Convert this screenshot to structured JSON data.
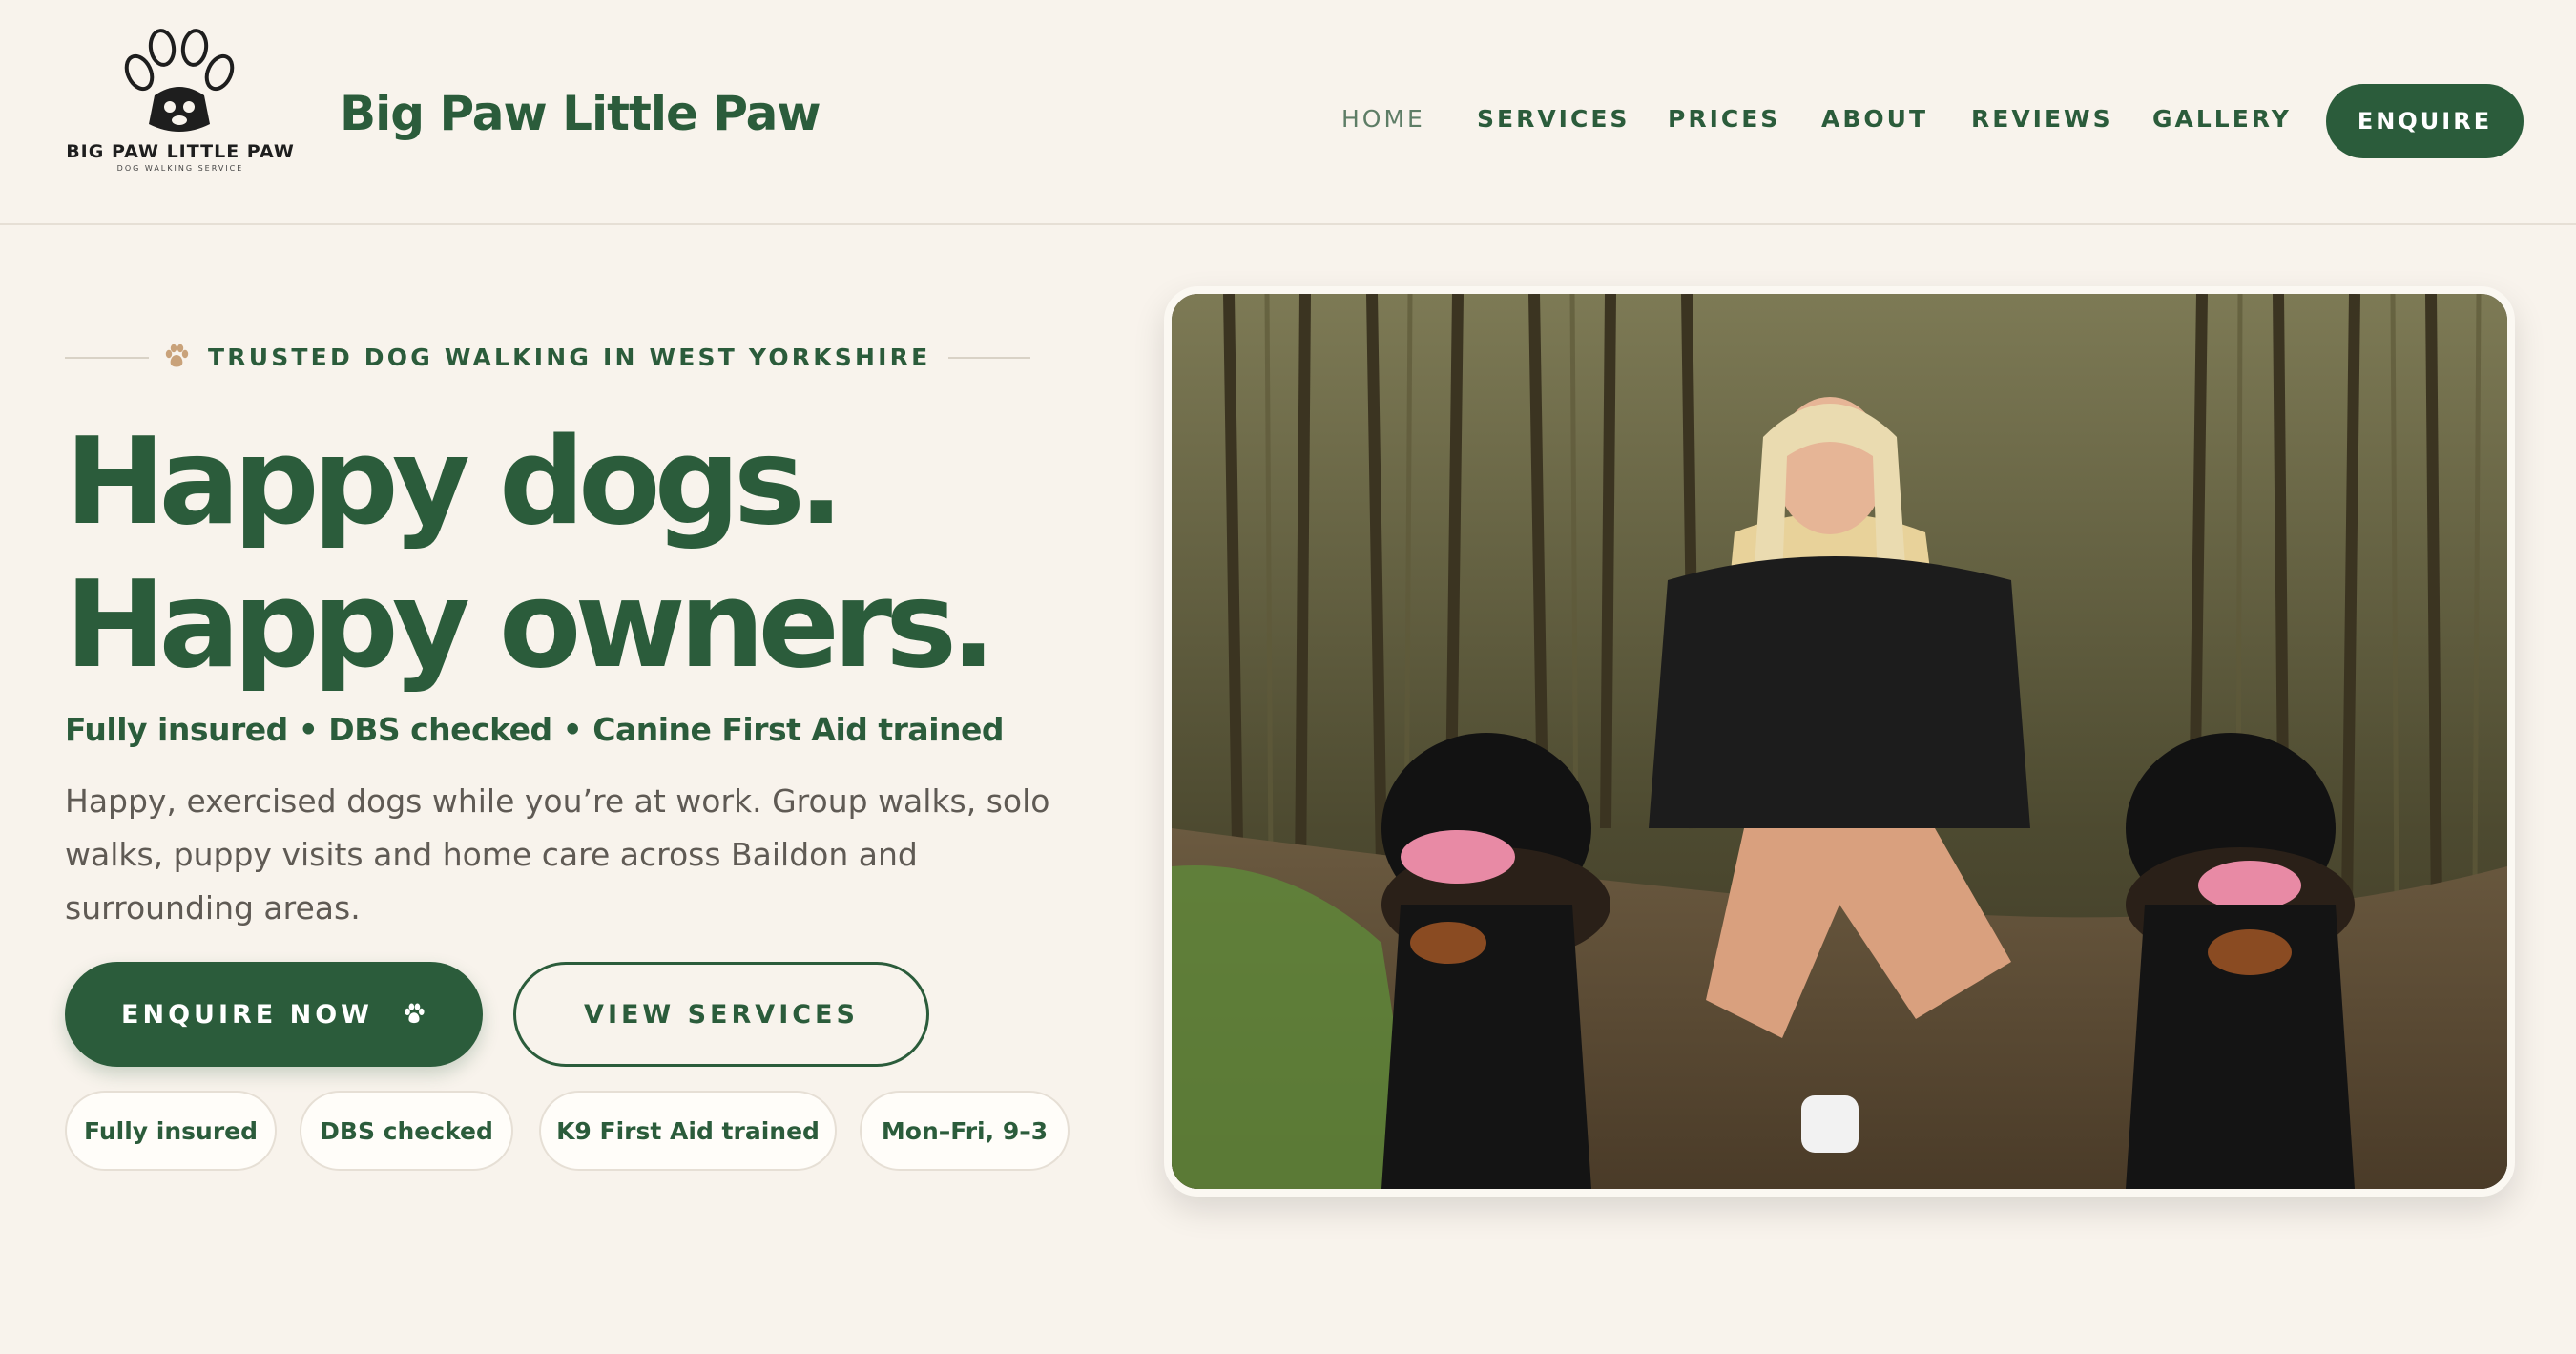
{
  "header": {
    "logo": {
      "title": "BIG PAW LITTLE PAW",
      "subtitle": "DOG WALKING SERVICE",
      "icon": "paw-print-with-dog-logo"
    },
    "brand_name": "Big Paw Little Paw",
    "nav": [
      {
        "label": "HOME",
        "active": true
      },
      {
        "label": "SERVICES",
        "active": false
      },
      {
        "label": "PRICES",
        "active": false
      },
      {
        "label": "ABOUT",
        "active": false
      },
      {
        "label": "REVIEWS",
        "active": false
      },
      {
        "label": "GALLERY",
        "active": false
      }
    ],
    "cta_label": "ENQUIRE"
  },
  "hero": {
    "eyebrow": "TRUSTED DOG WALKING IN WEST YORKSHIRE",
    "eyebrow_icon": "paw-icon",
    "headline_line1": "Happy dogs.",
    "headline_line2": "Happy owners.",
    "credentials": "Fully insured • DBS checked • Canine First Aid trained",
    "intro": "Happy, exercised dogs while you’re at work. Group walks, solo walks, puppy visits and home care across Baildon and surrounding areas.",
    "primary_button": "ENQUIRE NOW",
    "primary_button_icon": "paw-icon",
    "secondary_button": "VIEW SERVICES",
    "chips": [
      "Fully insured",
      "DBS checked",
      "K9 First Aid trained",
      "Mon–Fri, 9–3"
    ],
    "photo_description_icon": "hero-photo"
  },
  "colors": {
    "brand_green": "#2b5c3b",
    "background": "#f8f3ec",
    "muted_text": "#5f5a54",
    "accent_paw": "#c9a27a"
  }
}
